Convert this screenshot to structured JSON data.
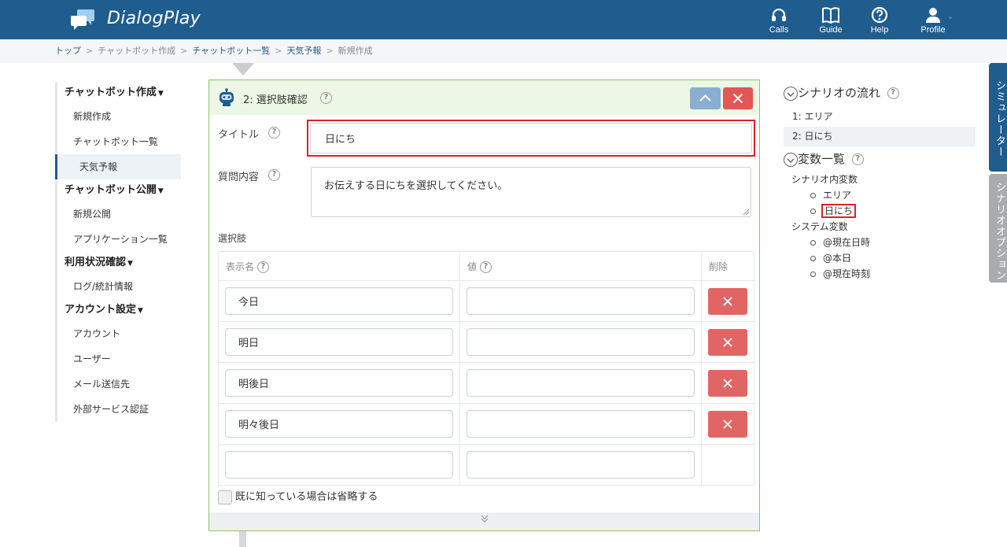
{
  "header": {
    "brand": "DialogPlay",
    "nav": [
      {
        "label": "Calls",
        "icon": "headset-icon"
      },
      {
        "label": "Guide",
        "icon": "book-icon"
      },
      {
        "label": "Help",
        "icon": "help-circle-icon"
      },
      {
        "label": "Profile",
        "icon": "user-icon"
      }
    ],
    "colors": {
      "header_bg": "#1f5d8f",
      "accent_red": "#d8232a",
      "card_border": "#8cc46d"
    }
  },
  "breadcrumb": {
    "items": [
      "トップ",
      "チャットボット作成",
      "チャットボット一覧",
      "天気予報",
      "新規作成"
    ],
    "separator": ">"
  },
  "sidebar": {
    "sections": [
      {
        "title": "チャットボット作成",
        "items": [
          "新規作成",
          "チャットボット一覧",
          "天気予報"
        ]
      },
      {
        "title": "チャットボット公開",
        "items": [
          "新規公開",
          "アプリケーション一覧"
        ]
      },
      {
        "title": "利用状況確認",
        "items": [
          "ログ/統計情報"
        ]
      },
      {
        "title": "アカウント設定",
        "items": [
          "アカウント",
          "ユーザー",
          "メール送信先",
          "外部サービス認証"
        ]
      }
    ],
    "active_item": "天気予報"
  },
  "card": {
    "title": "2: 選択肢確認",
    "title_label": "タイトル",
    "title_value": "日にち",
    "question_label": "質問内容",
    "question_value": "お伝えする日にちを選択してください。",
    "choices_label": "選択肢",
    "columns": {
      "display": "表示名",
      "value": "値",
      "delete": "削除"
    },
    "rows": [
      {
        "display": "今日",
        "value": ""
      },
      {
        "display": "明日",
        "value": ""
      },
      {
        "display": "明後日",
        "value": ""
      },
      {
        "display": "明々後日",
        "value": ""
      },
      {
        "display": "",
        "value": ""
      }
    ],
    "skip_label": "既に知っている場合は省略する",
    "skip_checked": false
  },
  "right_panel": {
    "flow_title": "シナリオの流れ",
    "flow_items": [
      {
        "label": "1: エリア",
        "icon": "building-icon"
      },
      {
        "label": "2: 日にち",
        "icon": "choice-icon"
      }
    ],
    "vars_title": "変数一覧",
    "scenario_vars_title": "シナリオ内変数",
    "scenario_vars": [
      "エリア",
      "日にち"
    ],
    "system_vars_title": "システム変数",
    "system_vars": [
      "@現在日時",
      "@本日",
      "@現在時刻"
    ]
  },
  "tabs": {
    "simulator": "シミュレーター",
    "options": "シナリオオプション"
  }
}
